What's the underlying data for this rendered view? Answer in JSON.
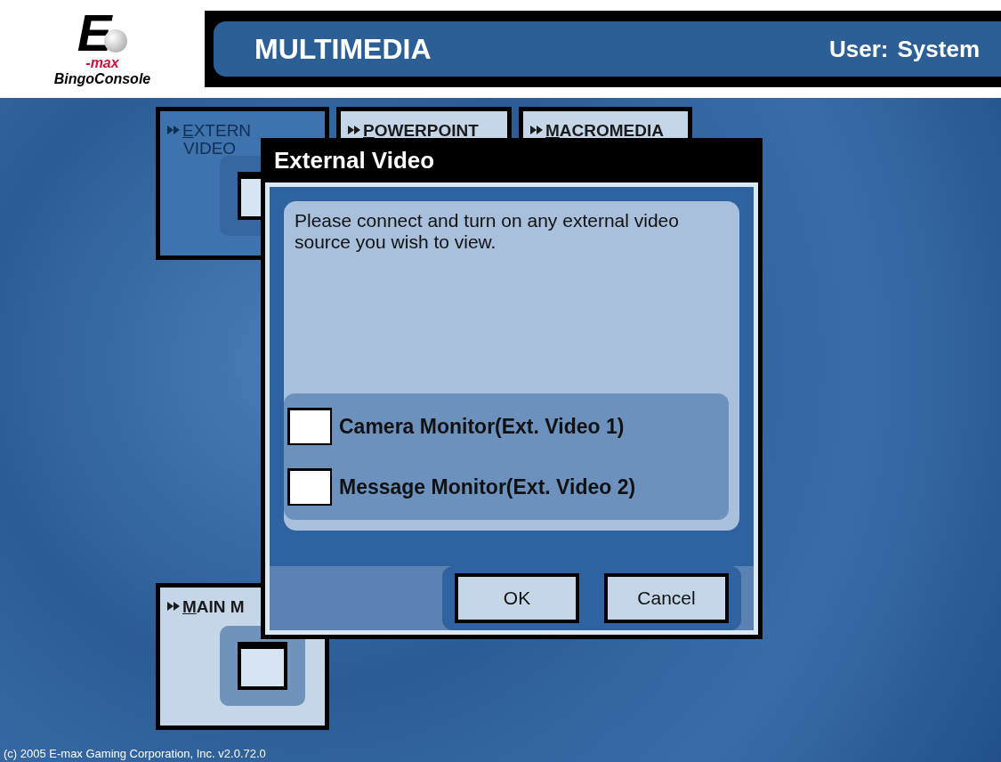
{
  "header": {
    "logo_mark": "E",
    "logo_script": "-max",
    "logo_text": "BingoConsole",
    "title": "MULTIMEDIA",
    "user_label": "User:",
    "user_name": "System"
  },
  "tiles": [
    {
      "label": "EXTERN",
      "label_line2": "VIDEO",
      "selected": true
    },
    {
      "label": "POWERPOINT",
      "selected": false
    },
    {
      "label": "MACROMEDIA",
      "selected": false
    },
    {
      "label": "MAIN M",
      "selected": false
    }
  ],
  "dialog": {
    "title": "External Video",
    "message": "Please connect and turn on any external video source you wish to view.",
    "options": [
      {
        "label": "Camera Monitor(Ext. Video 1)",
        "checked": false
      },
      {
        "label": "Message Monitor(Ext. Video 2)",
        "checked": false
      }
    ],
    "buttons": [
      "OK",
      "Cancel"
    ]
  },
  "footer": "(c) 2005 E-max Gaming Corporation, Inc. v2.0.72.0"
}
